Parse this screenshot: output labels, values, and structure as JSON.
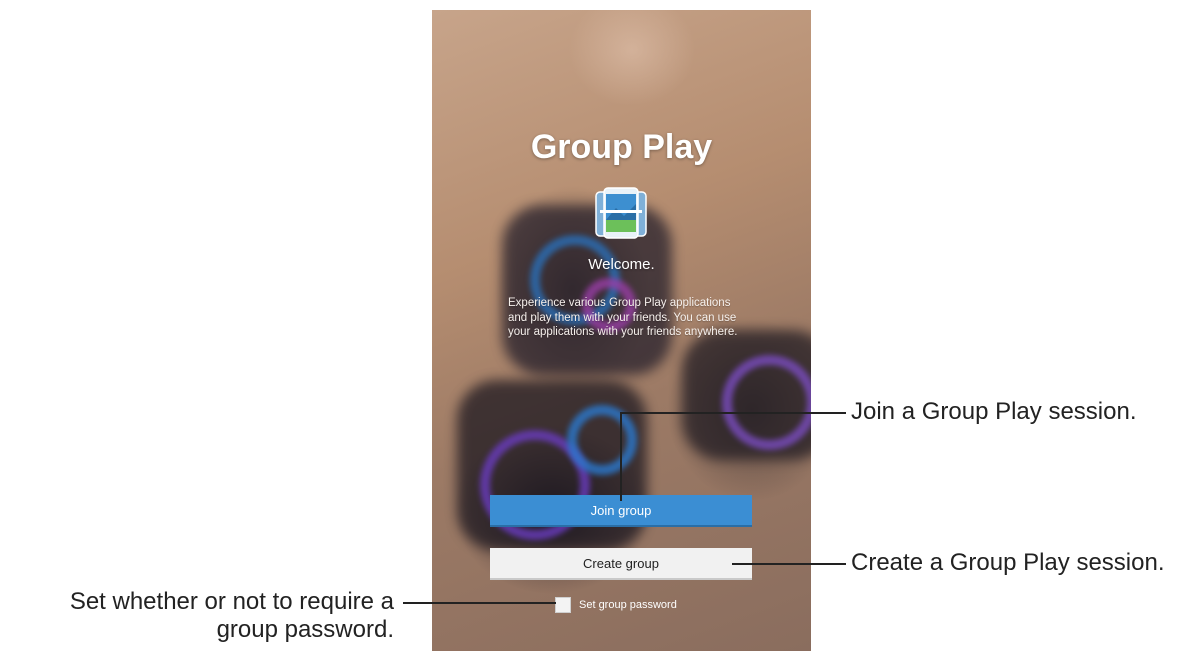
{
  "app": {
    "title": "Group Play",
    "welcome": "Welcome.",
    "description": "Experience various Group Play applications and play them with your friends. You can use your applications with your friends anywhere.",
    "icon": "group-play-app-icon"
  },
  "buttons": {
    "join": "Join group",
    "create": "Create group"
  },
  "password": {
    "label": "Set group password",
    "checked": false
  },
  "callouts": {
    "join": "Join a Group Play session.",
    "create": "Create a Group Play session.",
    "password": "Set whether or not to require a group password."
  },
  "colors": {
    "accent": "#3b8ed3",
    "secondary_button": "#f1f1f1"
  }
}
